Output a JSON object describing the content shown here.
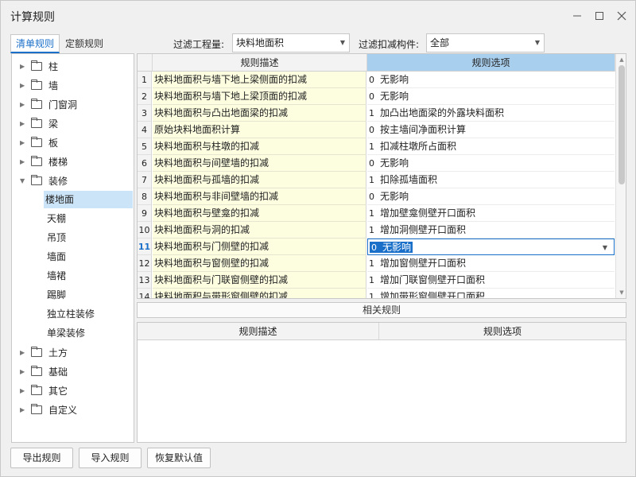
{
  "window": {
    "title": "计算规则"
  },
  "tabs": [
    "清单规则",
    "定额规则"
  ],
  "filters": {
    "project_label": "过滤工程量:",
    "project_value": "块料地面积",
    "deduct_label": "过滤扣减构件:",
    "deduct_value": "全部"
  },
  "tree": {
    "folders_top": [
      "柱",
      "墙",
      "门窗洞",
      "梁",
      "板",
      "楼梯",
      "装修"
    ],
    "children": [
      "楼地面",
      "天棚",
      "吊顶",
      "墙面",
      "墙裙",
      "踢脚",
      "独立柱装修",
      "单梁装修"
    ],
    "folders_bottom": [
      "土方",
      "基础",
      "其它",
      "自定义"
    ]
  },
  "grid": {
    "col_desc": "规则描述",
    "col_option": "规则选项",
    "rows": [
      {
        "num": "1",
        "desc": "块料地面积与墙下地上梁侧面的扣减",
        "code": "0",
        "option": "无影响"
      },
      {
        "num": "2",
        "desc": "块料地面积与墙下地上梁顶面的扣减",
        "code": "0",
        "option": "无影响"
      },
      {
        "num": "3",
        "desc": "块料地面积与凸出地面梁的扣减",
        "code": "1",
        "option": "加凸出地面梁的外露块料面积"
      },
      {
        "num": "4",
        "desc": "原始块料地面积计算",
        "code": "0",
        "option": "按主墙间净面积计算"
      },
      {
        "num": "5",
        "desc": "块料地面积与柱墩的扣减",
        "code": "1",
        "option": "扣减柱墩所占面积"
      },
      {
        "num": "6",
        "desc": "块料地面积与间壁墙的扣减",
        "code": "0",
        "option": "无影响"
      },
      {
        "num": "7",
        "desc": "块料地面积与孤墙的扣减",
        "code": "1",
        "option": "扣除孤墙面积"
      },
      {
        "num": "8",
        "desc": "块料地面积与非间壁墙的扣减",
        "code": "0",
        "option": "无影响"
      },
      {
        "num": "9",
        "desc": "块料地面积与壁龛的扣减",
        "code": "1",
        "option": "增加壁龛侧壁开口面积"
      },
      {
        "num": "10",
        "desc": "块料地面积与洞的扣减",
        "code": "1",
        "option": "增加洞侧壁开口面积"
      },
      {
        "num": "11",
        "desc": "块料地面积与门侧壁的扣减",
        "code": "0",
        "option": "无影响"
      },
      {
        "num": "12",
        "desc": "块料地面积与窗侧壁的扣减",
        "code": "1",
        "option": "增加窗侧壁开口面积"
      },
      {
        "num": "13",
        "desc": "块料地面积与门联窗侧壁的扣减",
        "code": "1",
        "option": "增加门联窗侧壁开口面积"
      },
      {
        "num": "14",
        "desc": "块料地面积与带形窗侧壁的扣减",
        "code": "1",
        "option": "增加带形窗侧壁开口面积"
      }
    ]
  },
  "related": {
    "title": "相关规则",
    "col_desc": "规则描述",
    "col_option": "规则选项"
  },
  "buttons": {
    "export": "导出规则",
    "import": "导入规则",
    "restore": "恢复默认值"
  },
  "colors": {
    "accent": "#1a6fc9",
    "desc_bg": "#fdfde0",
    "selected_header": "#a9cfee"
  }
}
